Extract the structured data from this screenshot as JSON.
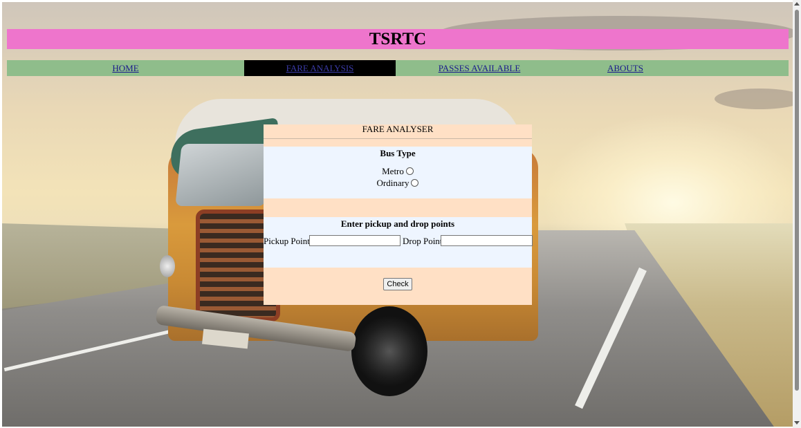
{
  "header": {
    "title": "TSRTC"
  },
  "nav": {
    "items": [
      {
        "label": "HOME"
      },
      {
        "label": "FARE ANALYSIS"
      },
      {
        "label": "PASSES AVAILABLE"
      },
      {
        "label": "ABOUTS"
      }
    ],
    "active": "FARE ANALYSIS"
  },
  "fare_analyser": {
    "title": "FARE ANALYSER",
    "bus_type": {
      "heading": "Bus Type",
      "options": [
        "Metro",
        "Ordinary"
      ]
    },
    "points": {
      "heading": "Enter pickup and drop points",
      "pickup_label": "Pickup Point",
      "pickup_value": "",
      "drop_label": "Drop Point",
      "drop_value": ""
    },
    "check_label": "Check"
  },
  "colors": {
    "title_bar": "#ee75cc",
    "nav_bar": "#8fbd8b",
    "nav_active": "#000000",
    "panel": "#ffe0c5",
    "panel_section": "#eef5ff"
  }
}
